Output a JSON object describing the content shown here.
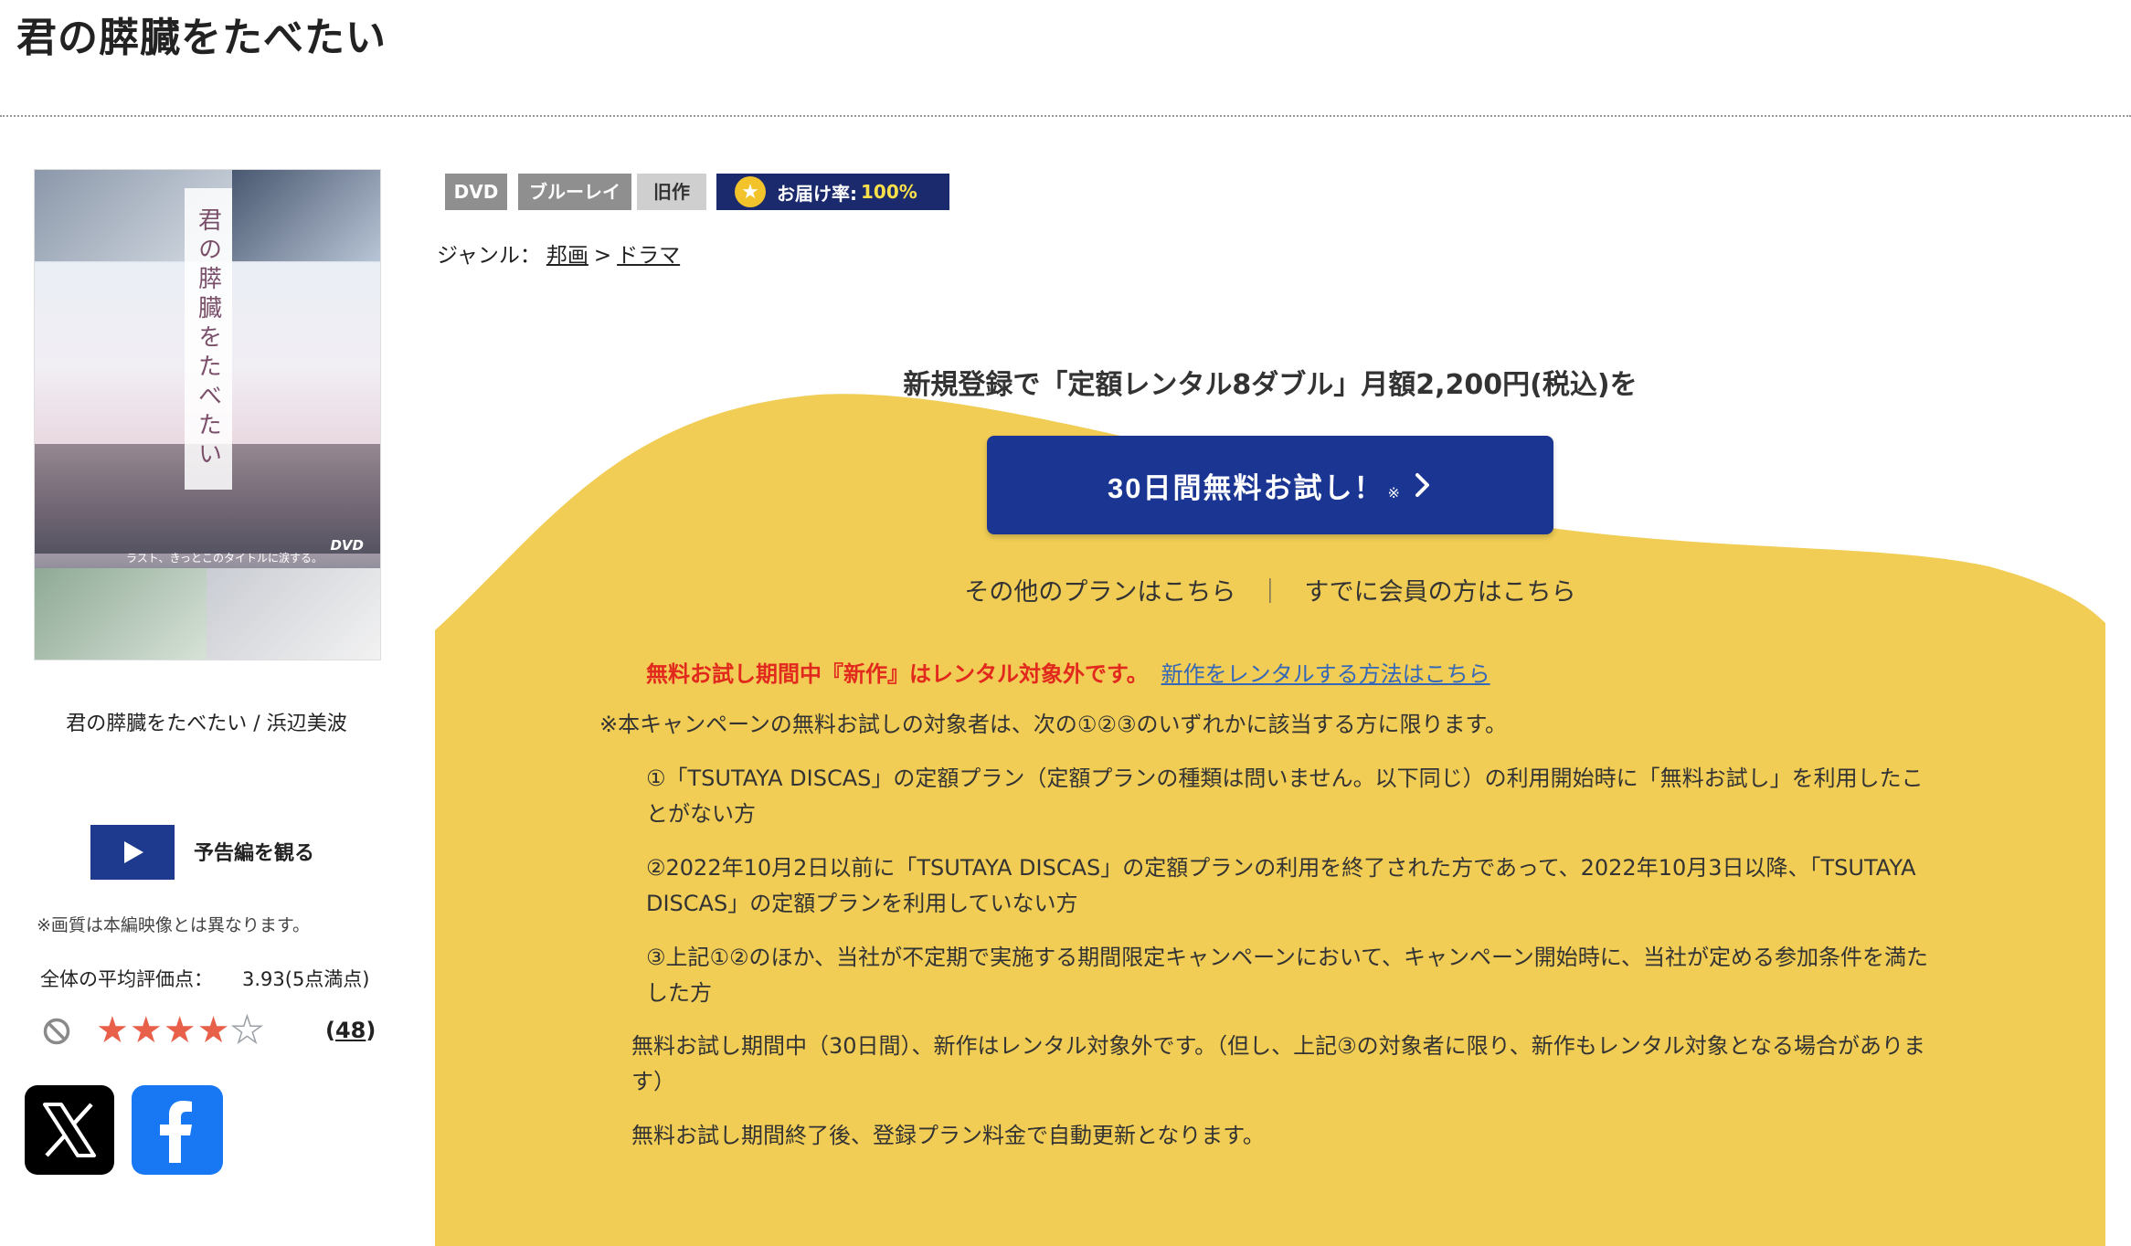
{
  "page": {
    "title": "君の膵臓をたべたい"
  },
  "poster": {
    "vertical_title": "君の膵臓をたべたい",
    "tagline": "ラスト、きっとこのタイトルに涙する。",
    "dvd_logo": "DVD",
    "caption": "君の膵臓をたべたい / 浜辺美波"
  },
  "trailer": {
    "label": "予告編を観る"
  },
  "image_note": "※画質は本編映像とは異なります。",
  "rating": {
    "label": "全体の平均評価点：",
    "value": "3.93(5点満点)",
    "stars_filled": 4,
    "stars_total": 5,
    "review_count": "48",
    "count_open": "(",
    "count_close": ")"
  },
  "tags": {
    "dvd": "DVD",
    "bluray": "ブルーレイ",
    "old": "旧作"
  },
  "delivery": {
    "label": "お届け率:",
    "value": "100%"
  },
  "genre": {
    "label": "ジャンル：",
    "level1": "邦画",
    "separator": ">",
    "level2": "ドラマ"
  },
  "campaign": {
    "headline": "新規登録で「定額レンタル8ダブル」月額2,200円(税込)を",
    "trial_button": "30日間無料お試し！",
    "trial_note_mark": "※",
    "other_plans": "その他のプランはこちら",
    "separator": "｜",
    "members": "すでに会員の方はこちら",
    "warning": "無料お試し期間中『新作』はレンタル対象外です。",
    "warning_link": "新作をレンタルする方法はこちら",
    "note_intro": "※本キャンペーンの無料お試しの対象者は、次の①②③のいずれかに該当する方に限ります。",
    "note_1": "①「TSUTAYA DISCAS」の定額プラン（定額プランの種類は問いません。以下同じ）の利用開始時に「無料お試し」を利用したことがない方",
    "note_2": "②2022年10月2日以前に「TSUTAYA DISCAS」の定額プランの利用を終了された方であって、2022年10月3日以降、「TSUTAYA DISCAS」の定額プランを利用していない方",
    "note_3": "③上記①②のほか、当社が不定期で実施する期間限定キャンペーンにおいて、キャンペーン開始時に、当社が定める参加条件を満たした方",
    "note_4": "無料お試し期間中（30日間）、新作はレンタル対象外です。（但し、上記③の対象者に限り、新作もレンタル対象となる場合があります）",
    "note_5": "無料お試し期間終了後、登録プラン料金で自動更新となります。"
  },
  "colors": {
    "accent_blue": "#1b3593",
    "campaign_yellow": "#f1cd55",
    "warning_red": "#e2291e",
    "link_blue": "#3567b8",
    "star_red": "#e9604a"
  },
  "icons": {
    "trailer": "play-icon",
    "delivery": "star-icon",
    "rating_disabled": "ban-icon",
    "share_x": "x-logo-icon",
    "share_facebook": "facebook-logo-icon",
    "button_arrow": "chevron-right-icon"
  }
}
